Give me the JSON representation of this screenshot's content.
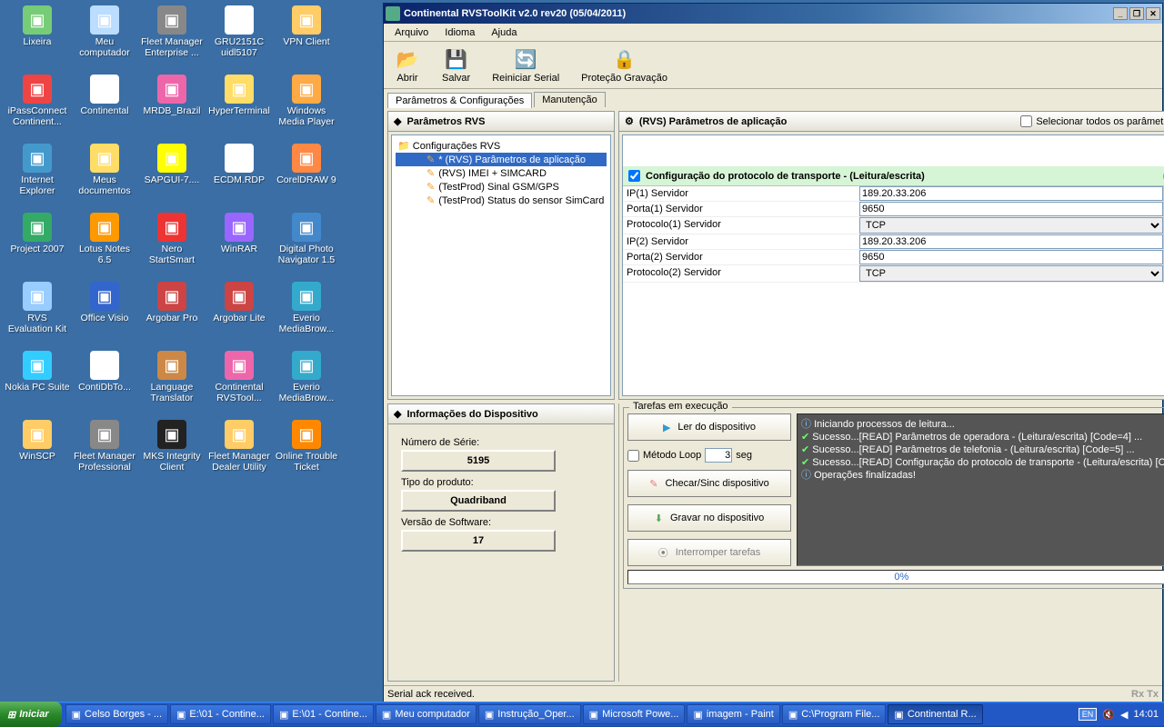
{
  "desktop_icons": [
    {
      "label": "Lixeira",
      "c": "#7c7"
    },
    {
      "label": "Meu computador",
      "c": "#bdf"
    },
    {
      "label": "Fleet Manager Enterprise ...",
      "c": "#888"
    },
    {
      "label": "GRU2151C uidl5107",
      "c": "#fff"
    },
    {
      "label": "VPN Client",
      "c": "#fc6"
    },
    {
      "label": "iPassConnect Continent...",
      "c": "#e44"
    },
    {
      "label": "Continental",
      "c": "#fff"
    },
    {
      "label": "MRDB_Brazil",
      "c": "#e6a"
    },
    {
      "label": "HyperTerminal",
      "c": "#fd6"
    },
    {
      "label": "Windows Media Player",
      "c": "#fa4"
    },
    {
      "label": "Internet Explorer",
      "c": "#49c"
    },
    {
      "label": "Meus documentos",
      "c": "#fd6"
    },
    {
      "label": "SAPGUI-7....",
      "c": "#ff0"
    },
    {
      "label": "ECDM.RDP",
      "c": "#fff"
    },
    {
      "label": "CorelDRAW 9",
      "c": "#f84"
    },
    {
      "label": "Project 2007",
      "c": "#3a6"
    },
    {
      "label": "Lotus Notes 6.5",
      "c": "#f90"
    },
    {
      "label": "Nero StartSmart",
      "c": "#e33"
    },
    {
      "label": "WinRAR",
      "c": "#96f"
    },
    {
      "label": "Digital Photo Navigator 1.5",
      "c": "#48c"
    },
    {
      "label": "RVS Evaluation Kit",
      "c": "#9cf"
    },
    {
      "label": "Office Visio",
      "c": "#36c"
    },
    {
      "label": "Argobar Pro",
      "c": "#c44"
    },
    {
      "label": "Argobar Lite",
      "c": "#c44"
    },
    {
      "label": "Everio MediaBrow...",
      "c": "#3ac"
    },
    {
      "label": "Nokia PC Suite",
      "c": "#3cf"
    },
    {
      "label": "ContiDbTo...",
      "c": "#fff"
    },
    {
      "label": "Language Translator",
      "c": "#c84"
    },
    {
      "label": "Continental RVSTool...",
      "c": "#e6a"
    },
    {
      "label": "Everio MediaBrow...",
      "c": "#3ac"
    },
    {
      "label": "WinSCP",
      "c": "#fc6"
    },
    {
      "label": "Fleet Manager Professional",
      "c": "#888"
    },
    {
      "label": "MKS Integrity Client",
      "c": "#222"
    },
    {
      "label": "Fleet Manager Dealer Utility",
      "c": "#fc6"
    },
    {
      "label": "Online Trouble Ticket",
      "c": "#f80"
    }
  ],
  "window": {
    "title": "Continental RVSToolKit v2.0 rev20 (05/04/2011)",
    "menu": [
      "Arquivo",
      "Idioma",
      "Ajuda"
    ],
    "toolbar": [
      {
        "label": "Abrir",
        "ico": "📂"
      },
      {
        "label": "Salvar",
        "ico": "💾"
      },
      {
        "label": "Reiniciar Serial",
        "ico": "🔄"
      },
      {
        "label": "Proteção Gravação",
        "ico": "🔒"
      }
    ],
    "tabs": [
      "Parâmetros & Configurações",
      "Manutenção"
    ],
    "tree_header": "Parâmetros RVS",
    "tree_root": "Configurações RVS",
    "tree_items": [
      "* (RVS) Parâmetros de aplicação",
      "(RVS) IMEI + SIMCARD",
      "(TestProd) Sinal GSM/GPS",
      "(TestProd) Status do sensor SimCard"
    ],
    "right_header": "(RVS) Parâmetros de aplicação",
    "select_all": "Selecionar todos os parâmetros",
    "section": "Configuração do protocolo de transporte - (Leitura/escrita)",
    "params": [
      {
        "label": "IP(1) Servidor",
        "value": "189.20.33.206",
        "type": "text"
      },
      {
        "label": "Porta(1) Servidor",
        "value": "9650",
        "type": "text"
      },
      {
        "label": "Protocolo(1) Servidor",
        "value": "TCP",
        "type": "select"
      },
      {
        "label": "IP(2) Servidor",
        "value": "189.20.33.206",
        "type": "text"
      },
      {
        "label": "Porta(2) Servidor",
        "value": "9650",
        "type": "text"
      },
      {
        "label": "Protocolo(2) Servidor",
        "value": "TCP",
        "type": "select"
      }
    ],
    "info_header": "Informações do Dispositivo",
    "info": {
      "serial_lab": "Número de Série:",
      "serial": "5195",
      "prod_lab": "Tipo do produto:",
      "prod": "Quadriband",
      "ver_lab": "Versão de Software:",
      "ver": "17"
    },
    "tasks": {
      "legend": "Tarefas em execução",
      "read": "Ler do dispositivo",
      "loop": "Método Loop",
      "loop_val": "3",
      "seg": "seg",
      "check": "Checar/Sinc dispositivo",
      "write": "Gravar no dispositivo",
      "stop": "Interromper tarefas"
    },
    "log": [
      {
        "t": "info",
        "txt": "Iniciando processos de leitura..."
      },
      {
        "t": "ok",
        "txt": "Sucesso...[READ] Parâmetros de operadora - (Leitura/escrita) [Code=4] ..."
      },
      {
        "t": "ok",
        "txt": "Sucesso...[READ] Parâmetros de telefonia - (Leitura/escrita) [Code=5] ..."
      },
      {
        "t": "ok",
        "txt": "Sucesso...[READ] Configuração do protocolo de transporte - (Leitura/escrita) [Co"
      },
      {
        "t": "info",
        "txt": "Operações finalizadas!"
      }
    ],
    "progress": "0%",
    "status": "Serial ack received.",
    "rxtx": "Rx Tx"
  },
  "taskbar": {
    "start": "Iniciar",
    "items": [
      "Celso Borges - ...",
      "E:\\01 - Contine...",
      "E:\\01 - Contine...",
      "Meu computador",
      "Instrução_Oper...",
      "Microsoft Powe...",
      "imagem - Paint",
      "C:\\Program File...",
      "Continental R..."
    ],
    "lang": "EN",
    "time": "14:01"
  }
}
